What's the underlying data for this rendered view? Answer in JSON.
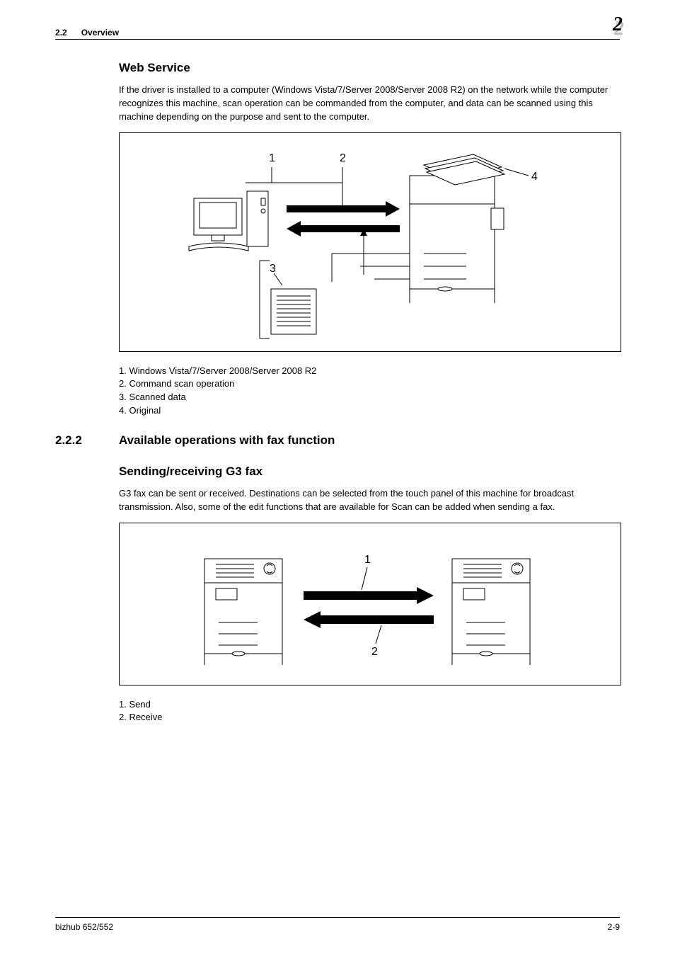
{
  "header": {
    "section_num": "2.2",
    "section_title": "Overview",
    "chapter": "2"
  },
  "sec1": {
    "heading": "Web Service",
    "para": "If the driver is installed to a computer (Windows Vista/7/Server 2008/Server 2008 R2) on the network while the computer recognizes this machine, scan operation can be commanded from the computer, and data can be scanned using this machine depending on the purpose and sent to the computer.",
    "callouts": {
      "c1": "1",
      "c2": "2",
      "c3": "3",
      "c4": "4"
    },
    "legend": {
      "l1": "1. Windows Vista/7/Server 2008/Server 2008 R2",
      "l2": "2. Command scan operation",
      "l3": "3. Scanned data",
      "l4": "4. Original"
    }
  },
  "sec2": {
    "number": "2.2.2",
    "title": "Available operations with fax function",
    "heading": "Sending/receiving G3 fax",
    "para": "G3 fax can be sent or received. Destinations can be selected from the touch panel of this machine for broadcast transmission. Also, some of the edit functions that are available for Scan can be added when sending a fax.",
    "callouts": {
      "c1": "1",
      "c2": "2"
    },
    "legend": {
      "l1": "1. Send",
      "l2": "2. Receive"
    }
  },
  "footer": {
    "left": "bizhub 652/552",
    "right": "2-9"
  }
}
